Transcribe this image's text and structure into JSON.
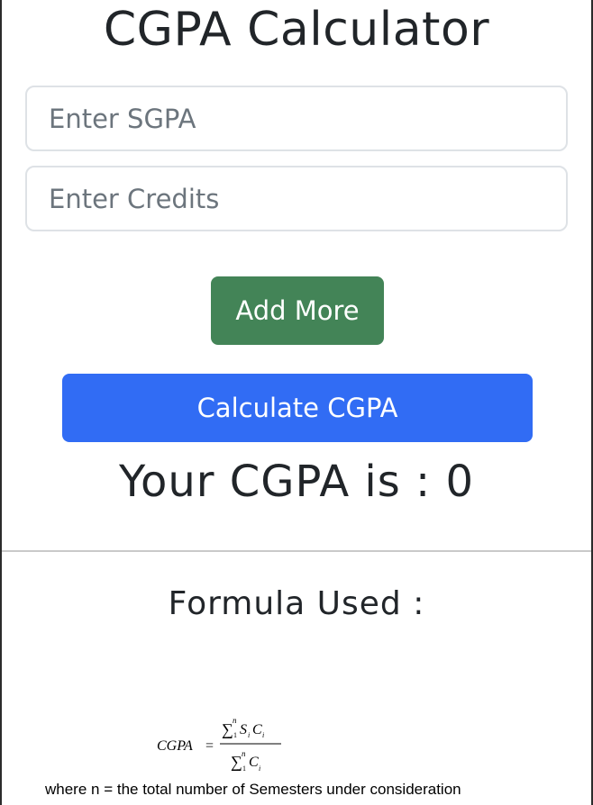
{
  "header": {
    "title": "CGPA Calculator"
  },
  "form": {
    "sgpa_placeholder": "Enter SGPA",
    "credits_placeholder": "Enter Credits",
    "add_more_label": "Add More",
    "calculate_label": "Calculate CGPA"
  },
  "result": {
    "text": "Your CGPA is : 0"
  },
  "formula": {
    "heading": "Formula Used :",
    "lhs": "CGPA",
    "equals": "=",
    "numerator_sigma": "∑",
    "numerator_upper": "n",
    "numerator_lower": "1",
    "numerator_s": "S",
    "numerator_s_sub": "i",
    "numerator_c": "C",
    "numerator_c_sub": "i",
    "denominator_sigma": "∑",
    "denominator_upper": "n",
    "denominator_lower": "1",
    "denominator_c": "C",
    "denominator_c_sub": "i",
    "footnote": "where n = the total number of Semesters under consideration"
  },
  "colors": {
    "add_more_button": "#438457",
    "calculate_button": "#316cf4",
    "text": "#212529",
    "placeholder": "#6c757d"
  }
}
